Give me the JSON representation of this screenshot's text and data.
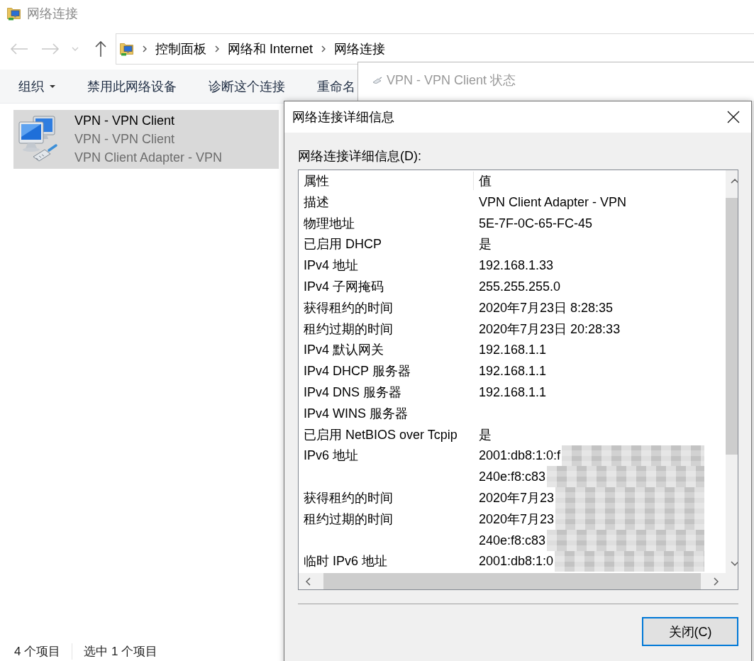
{
  "explorer": {
    "title": "网络连接",
    "nav": {
      "back": {
        "disabled": true
      },
      "forward": {
        "disabled": true
      },
      "up": {
        "disabled": false
      }
    },
    "breadcrumbs": [
      "控制面板",
      "网络和 Internet",
      "网络连接"
    ],
    "toolbar": [
      {
        "label": "组织",
        "dropdown": true
      },
      {
        "label": "禁用此网络设备",
        "dropdown": false
      },
      {
        "label": "诊断这个连接",
        "dropdown": false
      },
      {
        "label": "重命名",
        "dropdown": false
      }
    ],
    "items": [
      {
        "name": "VPN - VPN Client",
        "status": "VPN - VPN Client",
        "device": "VPN Client Adapter - VPN",
        "selected": true
      }
    ],
    "status_bar": [
      "4 个项目",
      "选中 1 个项目"
    ]
  },
  "status_window": {
    "title": "VPN - VPN Client 状态",
    "active": false
  },
  "details_dialog": {
    "title": "网络连接详细信息",
    "list_label": "网络连接详细信息(D):",
    "columns": [
      "属性",
      "值"
    ],
    "rows": [
      {
        "property": "描述",
        "value": "VPN Client Adapter - VPN",
        "redacted": false
      },
      {
        "property": "物理地址",
        "value": "5E-7F-0C-65-FC-45",
        "redacted": false
      },
      {
        "property": "已启用 DHCP",
        "value": "是",
        "redacted": false
      },
      {
        "property": "IPv4 地址",
        "value": "192.168.1.33",
        "redacted": false
      },
      {
        "property": "IPv4 子网掩码",
        "value": "255.255.255.0",
        "redacted": false
      },
      {
        "property": "获得租约的时间",
        "value": "2020年7月23日 8:28:35",
        "redacted": false
      },
      {
        "property": "租约过期的时间",
        "value": "2020年7月23日 20:28:33",
        "redacted": false
      },
      {
        "property": "IPv4 默认网关",
        "value": "192.168.1.1",
        "redacted": false
      },
      {
        "property": "IPv4 DHCP 服务器",
        "value": "192.168.1.1",
        "redacted": false
      },
      {
        "property": "IPv4 DNS 服务器",
        "value": "192.168.1.1",
        "redacted": false
      },
      {
        "property": "IPv4 WINS 服务器",
        "redacted": false
      },
      {
        "property": "已启用 NetBIOS over Tcpip",
        "value": "是",
        "redacted": false
      },
      {
        "property": "IPv6 地址",
        "value": "2001:db8:1:0:f",
        "redacted": true
      },
      {
        "value": "240e:f8:c83",
        "redacted": true
      },
      {
        "property": "获得租约的时间",
        "value": "2020年7月23",
        "redacted": true
      },
      {
        "property": "租约过期的时间",
        "value": "2020年7月23",
        "redacted": true
      },
      {
        "value": "240e:f8:c83",
        "redacted": true
      },
      {
        "property": "临时 IPv6 地址",
        "value": "2001:db8:1:0",
        "redacted": true
      }
    ],
    "close_button": {
      "label": "关闭(C)",
      "default": true
    }
  }
}
